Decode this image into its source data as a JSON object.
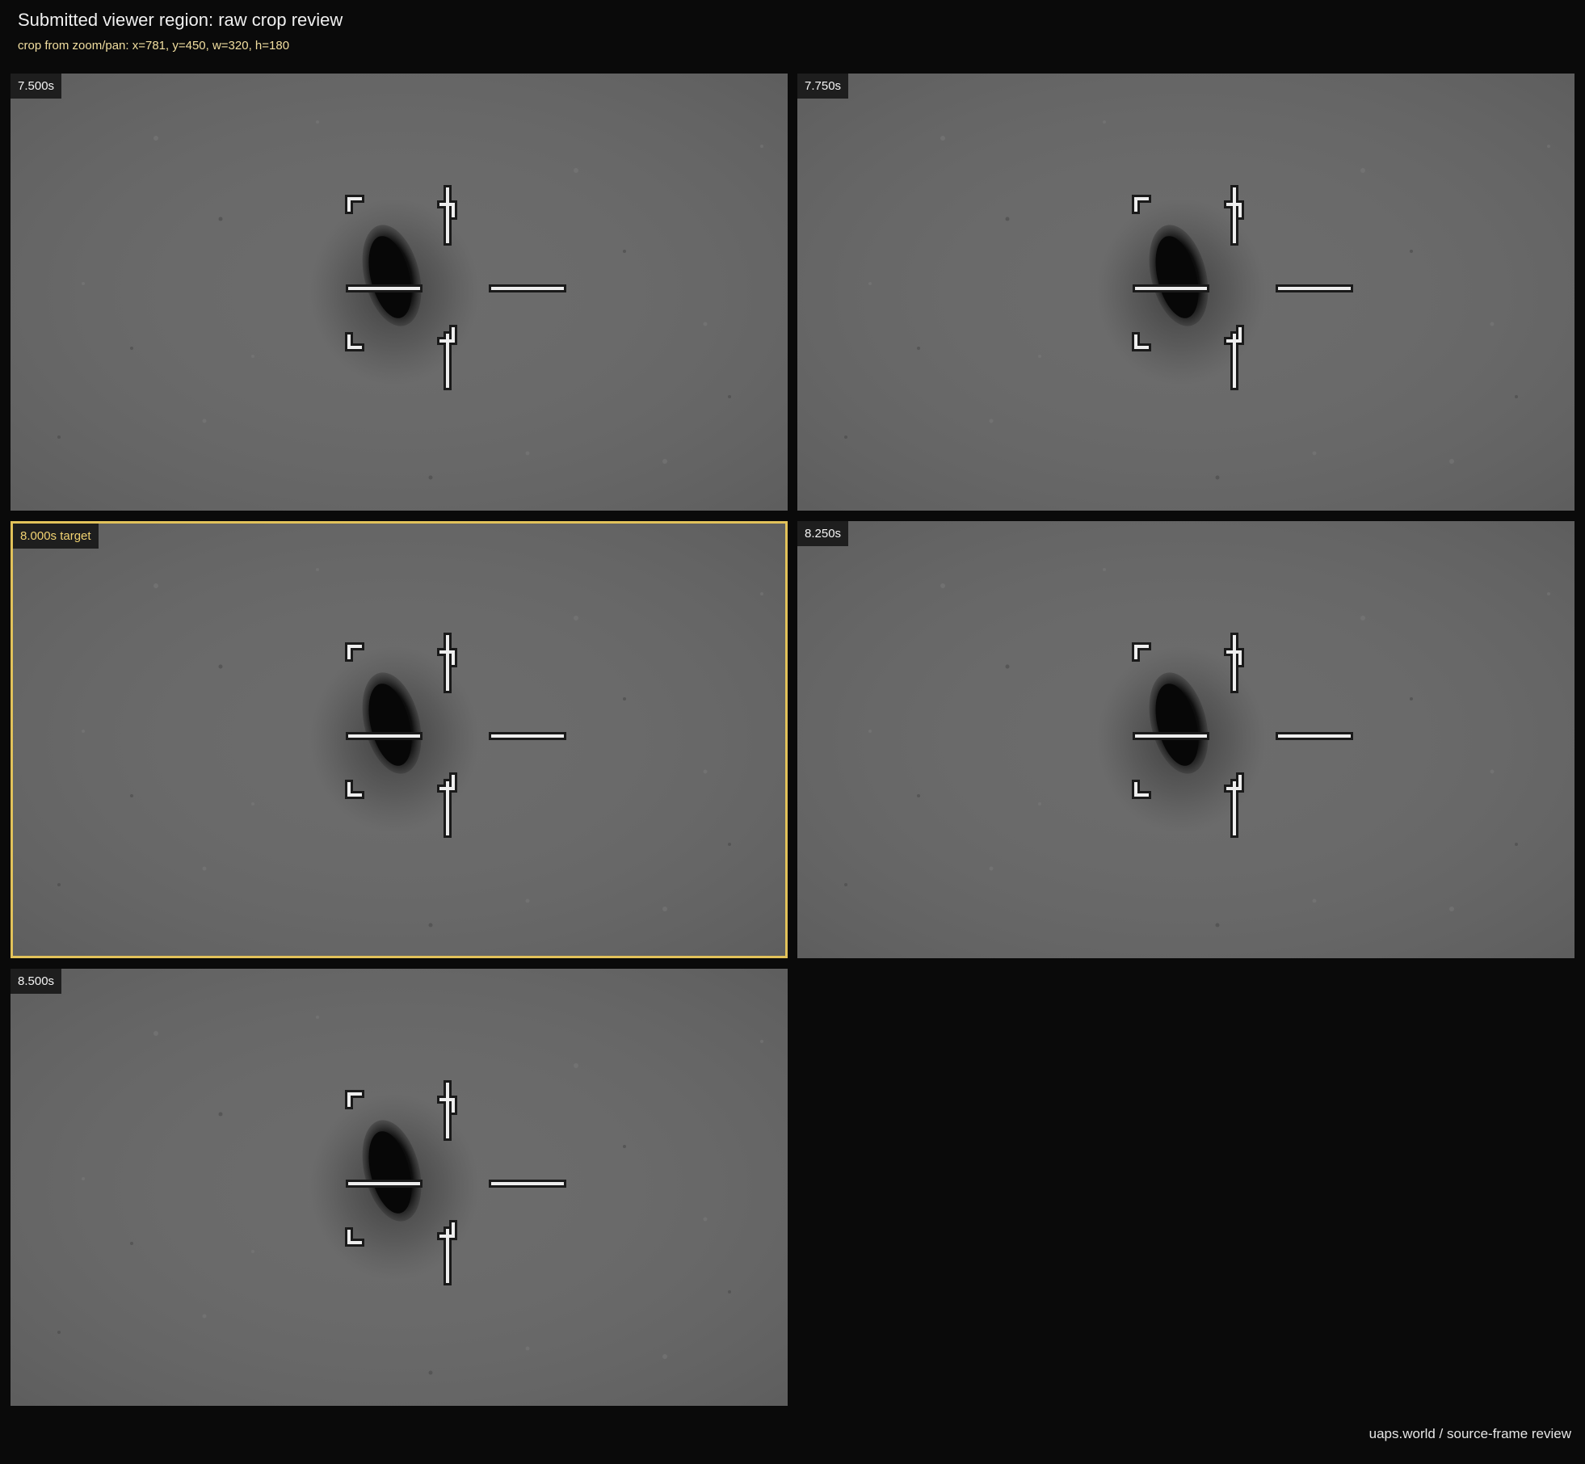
{
  "header": {
    "title": "Submitted viewer region: raw crop review",
    "subtitle": "crop from zoom/pan: x=781, y=450, w=320, h=180"
  },
  "frames": [
    {
      "label": "7.500s",
      "is_target": false
    },
    {
      "label": "7.750s",
      "is_target": false
    },
    {
      "label": "8.000s target",
      "is_target": true
    },
    {
      "label": "8.250s",
      "is_target": false
    },
    {
      "label": "8.500s",
      "is_target": false
    }
  ],
  "footer": {
    "credit": "uaps.world / source-frame review"
  },
  "colors": {
    "background": "#0a0a0a",
    "frame_gray": "#6c6c6c",
    "target_border": "#e2c25a",
    "subtitle_text": "#f2dfa0"
  }
}
